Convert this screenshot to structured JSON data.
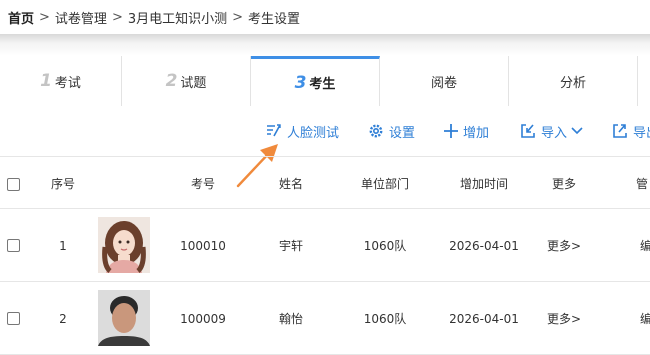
{
  "breadcrumb": {
    "items": [
      "首页",
      "试卷管理",
      "3月电工知识小测",
      "考生设置"
    ],
    "separator": ">"
  },
  "tabs": [
    {
      "num": "1",
      "label": "考试"
    },
    {
      "num": "2",
      "label": "试题"
    },
    {
      "num": "3",
      "label": "考生"
    },
    {
      "num": "",
      "label": "阅卷"
    },
    {
      "num": "",
      "label": "分析"
    }
  ],
  "active_tab": "考生",
  "toolbar": {
    "face_test": "人脸测试",
    "settings": "设置",
    "add": "增加",
    "import": "导入",
    "export": "导出"
  },
  "table": {
    "headers": [
      "序号",
      "考号",
      "姓名",
      "单位部门",
      "增加时间",
      "更多",
      "管"
    ],
    "rows": [
      {
        "index": "1",
        "exam_no": "100010",
        "name": "宇轩",
        "dept": "1060队",
        "added": "2026-04-01",
        "more": "更多>",
        "manage": "编"
      },
      {
        "index": "2",
        "exam_no": "100009",
        "name": "翰怡",
        "dept": "1060队",
        "added": "2026-04-01",
        "more": "更多>",
        "manage": "编"
      }
    ]
  },
  "colors": {
    "accent": "#3f8fe6",
    "link": "#2f7fd6",
    "annotation_arrow": "#f08a3c"
  }
}
